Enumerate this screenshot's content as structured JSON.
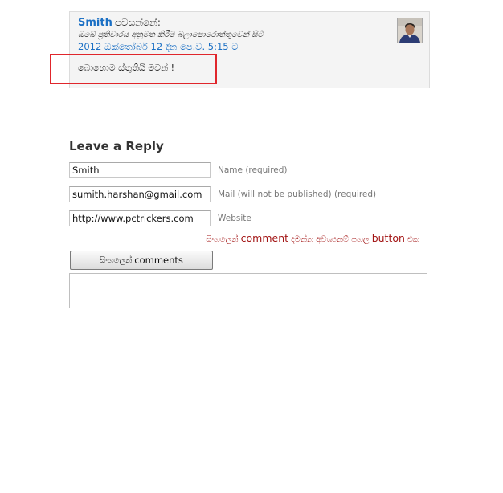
{
  "comment": {
    "author": "Smith",
    "author_suffix": "පවසන්නේ:",
    "moderation_note": "ඔබේ ප්‍රතිචාරය අනුමත කිරීම බලාපොරොත්තුවෙන් සිටී",
    "date": "2012 ඔක්තෝබර් 12 දින පෙ.ව. 5:15 ට",
    "text": "බොහොම ස්තුතියි මචන් !"
  },
  "reply": {
    "title": "Leave a Reply",
    "name": {
      "value": "Smith",
      "label": "Name (required)"
    },
    "mail": {
      "value": "sumith.harshan@gmail.com",
      "label": "Mail (will not be published) (required)"
    },
    "website": {
      "value": "http://www.pctrickers.com",
      "label": "Website"
    },
    "sinhala_note": {
      "part1": "සිංහලෙන් ",
      "part2": "comment",
      "part3": " දමන්න අවශ්‍යනම් පහල ",
      "part4": "button",
      "part5": " එක"
    },
    "sinhala_button": {
      "prefix": "සිංහලෙන්",
      "label": "comments"
    },
    "comment_value": ""
  },
  "colors": {
    "link": "#1a6fc4",
    "highlight": "#e0262c",
    "note": "#a31515"
  }
}
